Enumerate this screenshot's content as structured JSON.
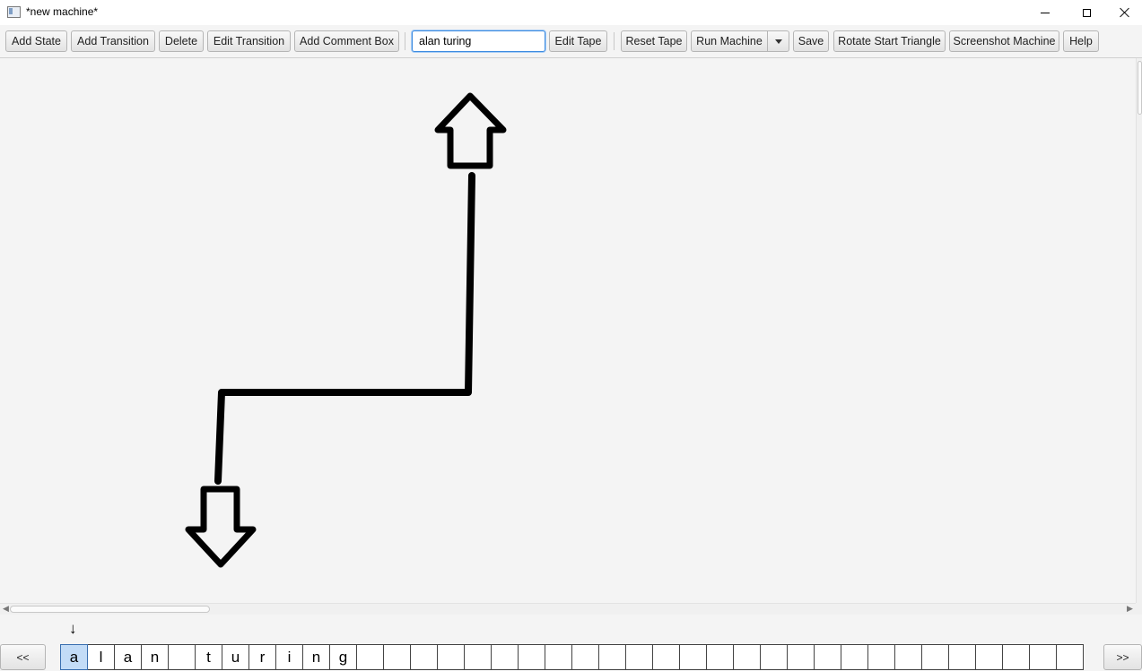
{
  "window": {
    "title": "*new machine*",
    "minimize_icon": "minimize-icon",
    "maximize_icon": "maximize-icon",
    "close_icon": "close-icon"
  },
  "toolbar": {
    "add_state": "Add State",
    "add_transition": "Add Transition",
    "delete": "Delete",
    "edit_transition": "Edit Transition",
    "add_comment_box": "Add Comment Box",
    "tape_input_value": "alan turing",
    "edit_tape": "Edit Tape",
    "reset_tape": "Reset Tape",
    "run_machine": "Run Machine",
    "save": "Save",
    "rotate_start_triangle": "Rotate Start Triangle",
    "screenshot_machine": "Screenshot Machine",
    "help": "Help"
  },
  "tape": {
    "head_symbol": "↓",
    "prev_label": "<<",
    "next_label": ">>",
    "head_index": 0,
    "cells": [
      "a",
      "l",
      "a",
      "n",
      "",
      "t",
      "u",
      "r",
      "i",
      "n",
      "g",
      "",
      "",
      "",
      "",
      "",
      "",
      "",
      "",
      "",
      "",
      "",
      "",
      "",
      "",
      "",
      "",
      "",
      "",
      "",
      "",
      "",
      "",
      "",
      "",
      "",
      "",
      ""
    ]
  },
  "colors": {
    "active_cell": "#c3dcf7",
    "canvas": "#f4f4f4",
    "input_focus": "#3c8be0"
  }
}
